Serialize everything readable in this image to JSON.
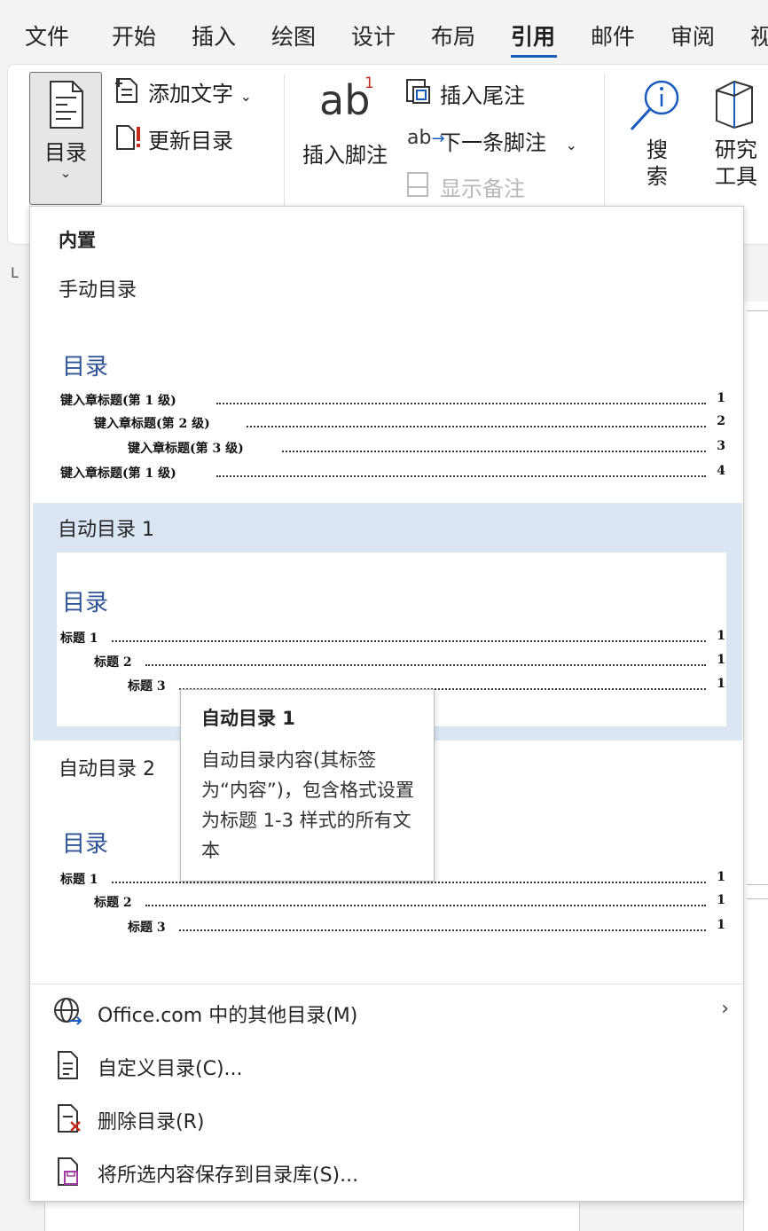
{
  "tabs": [
    "文件",
    "开始",
    "插入",
    "绘图",
    "设计",
    "布局",
    "引用",
    "邮件",
    "审阅",
    "视"
  ],
  "active_tab": "引用",
  "accent_color": "#185abd",
  "ribbon": {
    "toc_button": "目录",
    "add_text": "添加文字",
    "update_toc": "更新目录",
    "insert_footnote": "插入脚注",
    "insert_endnote": "插入尾注",
    "next_footnote": "下一条脚注",
    "show_notes": "显示备注",
    "search": "搜索",
    "research_tool": "研究工具"
  },
  "dropdown": {
    "section_builtin": "内置",
    "manual_label": "手动目录",
    "manual_preview": {
      "title": "目录",
      "entries": [
        {
          "text": "键入章标题(第 1 级)",
          "page": "1",
          "level": 1
        },
        {
          "text": "键入章标题(第 2 级)",
          "page": "2",
          "level": 2
        },
        {
          "text": "键入章标题(第 3 级)",
          "page": "3",
          "level": 3
        },
        {
          "text": "键入章标题(第 1 级)",
          "page": "4",
          "level": 1
        }
      ]
    },
    "auto1_label": "自动目录 1",
    "auto1_preview": {
      "title": "目录",
      "entries": [
        {
          "text": "标题 1",
          "page": "1",
          "level": 1
        },
        {
          "text": "标题 2",
          "page": "1",
          "level": 2
        },
        {
          "text": "标题 3",
          "page": "1",
          "level": 3
        }
      ]
    },
    "auto2_label": "自动目录 2",
    "auto2_preview": {
      "title": "目录",
      "entries": [
        {
          "text": "标题 1",
          "page": "1",
          "level": 1
        },
        {
          "text": "标题 2",
          "page": "1",
          "level": 2
        },
        {
          "text": "标题 3",
          "page": "1",
          "level": 3
        }
      ]
    },
    "menu": [
      {
        "label": "Office.com 中的其他目录(M)",
        "icon": "globe-icon",
        "submenu": true
      },
      {
        "label": "自定义目录(C)...",
        "icon": "document-icon",
        "submenu": false
      },
      {
        "label": "删除目录(R)",
        "icon": "delete-document-icon",
        "submenu": false
      },
      {
        "label": "将所选内容保存到目录库(S)...",
        "icon": "save-to-gallery-icon",
        "submenu": false
      }
    ]
  },
  "tooltip": {
    "title": "自动目录 1",
    "body": "自动目录内容(其标签为“内容”)，包含格式设置为标题 1-3 样式的所有文本"
  }
}
